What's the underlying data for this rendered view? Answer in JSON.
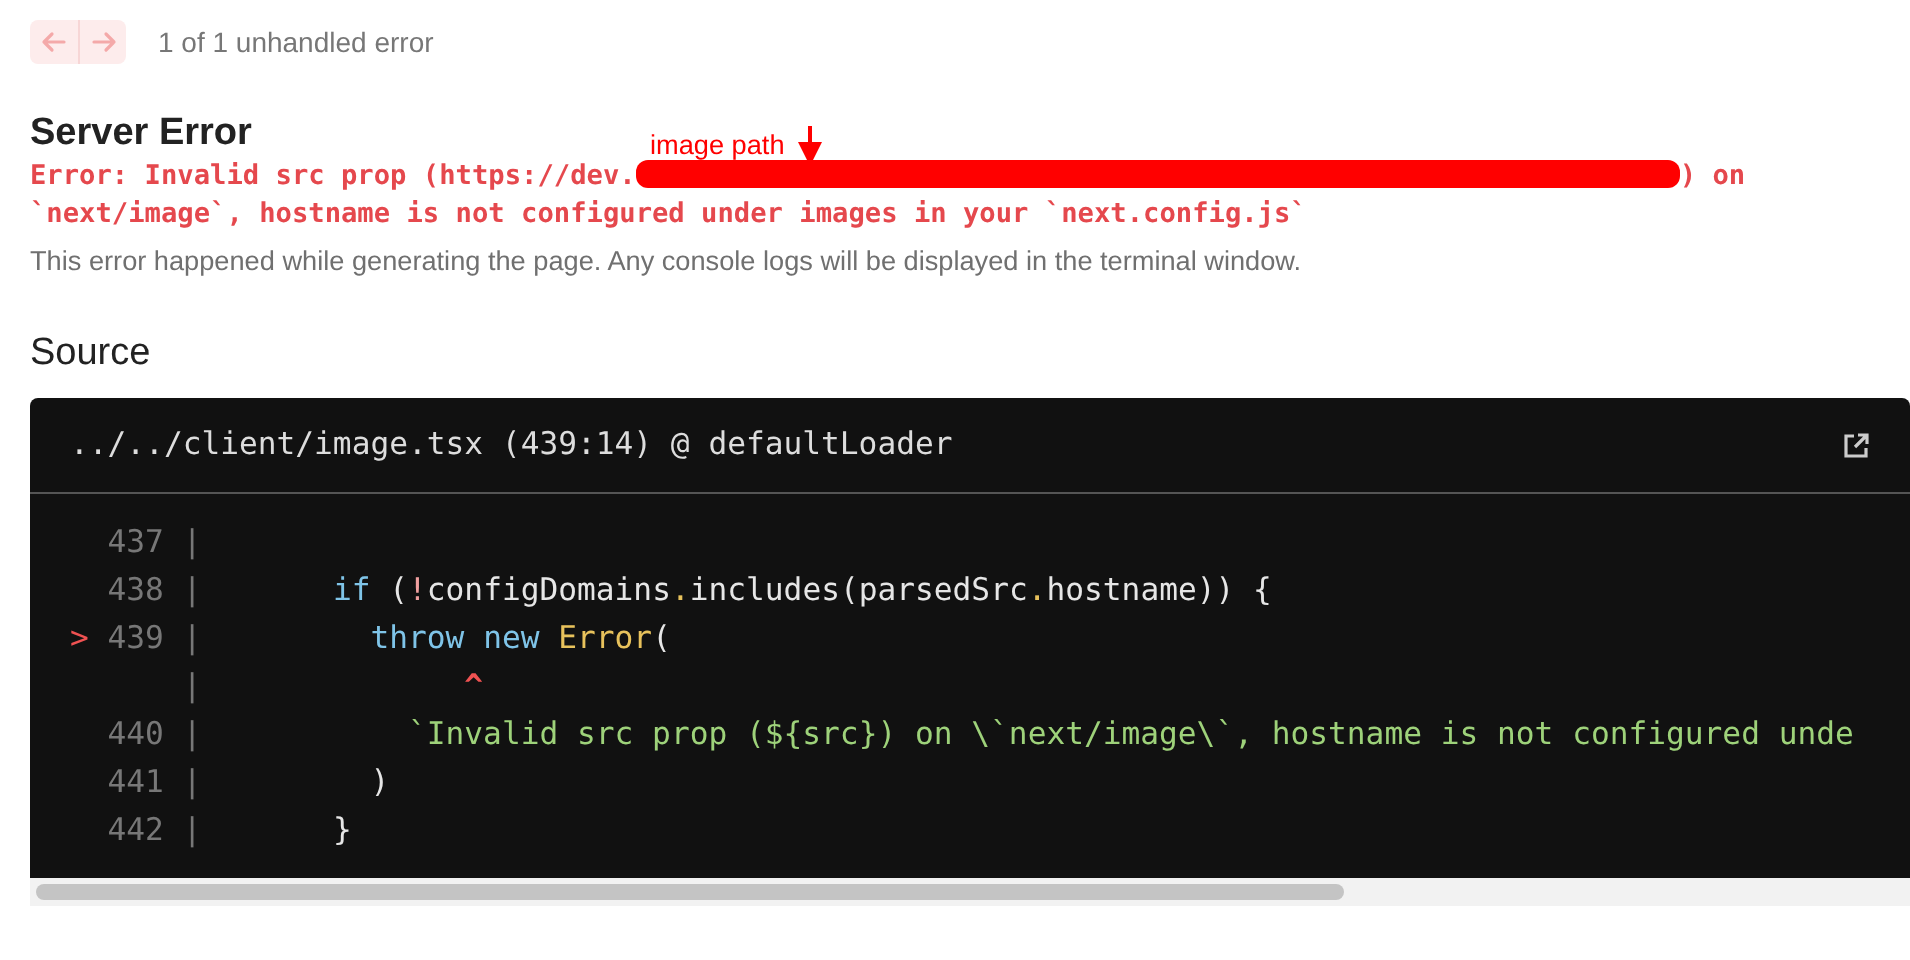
{
  "nav": {
    "buttons": [
      {
        "kind": "prev",
        "disabled": true
      },
      {
        "kind": "next",
        "disabled": true
      }
    ],
    "counter": "1 of 1 unhandled error"
  },
  "title": "Server Error",
  "error": {
    "before_redaction": "Error: Invalid src prop (https://dev.",
    "after_redaction": ") on",
    "line_2": "`next/image`, hostname is not configured under images in your `next.config.js`"
  },
  "annotation": {
    "label": "image path"
  },
  "note": "This error happened while generating the page. Any console logs will be displayed in the terminal window.",
  "source": {
    "heading": "Source",
    "file": "../../client/image.tsx (439:14) @ defaultLoader",
    "lines": [
      {
        "number": "437",
        "gutter": "|"
      },
      {
        "number": "438",
        "gutter": "|",
        "tokens": [
          {
            "kind": "keyword",
            "text": "       if"
          },
          {
            "kind": "plain",
            "text": " ("
          },
          {
            "kind": "operator",
            "text": "!"
          },
          {
            "kind": "plain",
            "text": "configDomains"
          },
          {
            "kind": "dot",
            "text": "."
          },
          {
            "kind": "plain",
            "text": "includes(parsedSrc"
          },
          {
            "kind": "dot",
            "text": "."
          },
          {
            "kind": "plain",
            "text": "hostname)) {"
          }
        ]
      },
      {
        "marker": ">",
        "number": "439",
        "gutter": "|",
        "tokens": [
          {
            "kind": "keyword",
            "text": "         throw "
          },
          {
            "kind": "keyword",
            "text": "new "
          },
          {
            "kind": "function",
            "text": "Error"
          },
          {
            "kind": "plain",
            "text": "("
          }
        ]
      },
      {
        "gutter": "|",
        "tokens": [
          {
            "kind": "caret",
            "text": "              ^"
          }
        ]
      },
      {
        "number": "440",
        "gutter": "|",
        "tokens": [
          {
            "kind": "string",
            "text": "           `Invalid src prop (${src}) on \\`next/image\\`, hostname is not configured unde"
          }
        ]
      },
      {
        "number": "441",
        "gutter": "|",
        "tokens": [
          {
            "kind": "plain",
            "text": "         )"
          }
        ]
      },
      {
        "number": "442",
        "gutter": "|",
        "tokens": [
          {
            "kind": "plain",
            "text": "       }"
          }
        ]
      }
    ]
  }
}
